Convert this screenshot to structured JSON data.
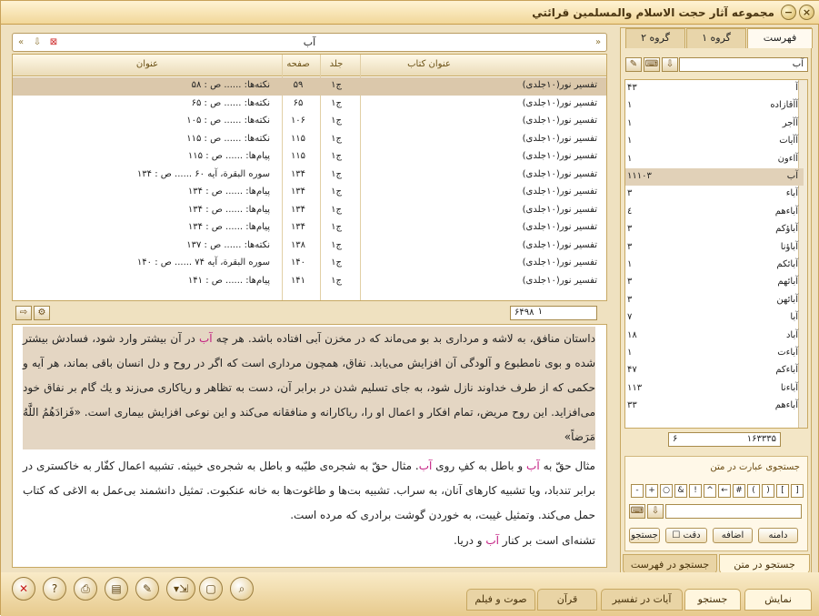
{
  "window": {
    "title": "مجموعه آثار حجت الاسلام والمسلمين قرائتي"
  },
  "search": {
    "query": "آب"
  },
  "table": {
    "headers": {
      "book": "عنوان کتاب",
      "vol": "جلد",
      "page": "صفحه",
      "title": "عنوان"
    },
    "rows": [
      {
        "book": "تفسير نور(١٠جلدى)",
        "vol": "ج١",
        "page": "۵٩",
        "title": "نکته‌ها: ...... ص : ۵٨"
      },
      {
        "book": "تفسير نور(١٠جلدى)",
        "vol": "ج١",
        "page": "۶۵",
        "title": "نکته‌ها: ...... ص : ۶۵"
      },
      {
        "book": "تفسير نور(١٠جلدى)",
        "vol": "ج١",
        "page": "١٠۶",
        "title": "نکته‌ها: ...... ص : ١٠۵"
      },
      {
        "book": "تفسير نور(١٠جلدى)",
        "vol": "ج١",
        "page": "١١۵",
        "title": "نکته‌ها: ...... ص : ١١۵"
      },
      {
        "book": "تفسير نور(١٠جلدى)",
        "vol": "ج١",
        "page": "١١۵",
        "title": "پيام‌ها: ...... ص : ١١۵"
      },
      {
        "book": "تفسير نور(١٠جلدى)",
        "vol": "ج١",
        "page": "١٣۴",
        "title": "سوره البقرة، آيه ۶٠ ...... ص : ١٣۴"
      },
      {
        "book": "تفسير نور(١٠جلدى)",
        "vol": "ج١",
        "page": "١٣۴",
        "title": "پيام‌ها: ...... ص : ١٣۴"
      },
      {
        "book": "تفسير نور(١٠جلدى)",
        "vol": "ج١",
        "page": "١٣۴",
        "title": "پيام‌ها: ...... ص : ١٣۴"
      },
      {
        "book": "تفسير نور(١٠جلدى)",
        "vol": "ج١",
        "page": "١٣۴",
        "title": "پيام‌ها: ...... ص : ١٣۴"
      },
      {
        "book": "تفسير نور(١٠جلدى)",
        "vol": "ج١",
        "page": "١٣٨",
        "title": "نکته‌ها: ...... ص : ١٣٧"
      },
      {
        "book": "تفسير نور(١٠جلدى)",
        "vol": "ج١",
        "page": "١۴٠",
        "title": "سوره البقرة، آيه ٧۴ ...... ص : ١۴٠"
      },
      {
        "book": "تفسير نور(١٠جلدى)",
        "vol": "ج١",
        "page": "١۴١",
        "title": "پيام‌ها: ...... ص : ١۴١"
      }
    ]
  },
  "pager": {
    "total": "۶۴٩٨",
    "current": "١"
  },
  "text": {
    "p1a": "داستان منافق، به لاشه و مردارى بد بو مى‌ماند كه در مخزن آبى افتاده باشد. هر چه ",
    "p1hl": "آب",
    "p1b": " در آن بيشتر وارد شود، فسادش بيشتر شده و بوى نامطبوع و آلودگى آن افزايش مى‌يابد. نفاق، همچون مردارى است كه اگر در روح و دل انسان باقى بماند، هر آيه و حكمى كه از طرف خداوند نازل شود، به جاى تسليم شدن در برابر آن، دست به تظاهر و رياكارى مى‌زند و يك گام بر نفاق خود مى‌افزايد. اين روح مريض، تمام افكار و اعمال او را، رياكارانه و منافقانه مى‌كند و اين نوعى افزايش بيمارى است. «فَزادَهُمُ اللَّهُ مَرَضاً»",
    "p2a": "مثال حقّ به ",
    "p2hl": "آب",
    "p2b": " و باطل به كفِ روى ",
    "p2hl2": "آب",
    "p2c": ". مثال حقّ به شجره‌ى طيّبه و باطل به شجره‌ى خبيثه. تشبيه اعمال كفّار به خاكسترى در برابر تندباد، ويا تشبيه كارهاى آنان، به سراب. تشبيه بت‌ها و طاغوت‌ها به خانه عنكبوت. تمثيل دانشمند بى‌عمل به الاغى كه كتاب حمل مى‌كند. وتمثيل غيبت، به خوردن گوشت برادرى كه مرده است.",
    "p3a": "تشنه‌اى است بر كنار ",
    "p3hl": "آب",
    "p3b": " و دريا."
  },
  "sidebar": {
    "tabs": [
      "فهرست",
      "گروه ١",
      "گروه ٢"
    ],
    "search": "آب",
    "items": [
      {
        "w": "آ",
        "c": "۴٣"
      },
      {
        "w": "آآقازاده",
        "c": "١"
      },
      {
        "w": "آآجر",
        "c": "١"
      },
      {
        "w": "آآيات",
        "c": "١"
      },
      {
        "w": "آاءون",
        "c": "١"
      },
      {
        "w": "آب",
        "c": "١١١٠٣"
      },
      {
        "w": "آباء",
        "c": "٣"
      },
      {
        "w": "آباءهم",
        "c": "٤"
      },
      {
        "w": "آباؤكم",
        "c": "٣"
      },
      {
        "w": "آباؤنا",
        "c": "٣"
      },
      {
        "w": "آبائكم",
        "c": "١"
      },
      {
        "w": "آبائهم",
        "c": "٣"
      },
      {
        "w": "آبائهن",
        "c": "٣"
      },
      {
        "w": "آبا",
        "c": "٧"
      },
      {
        "w": "آباد",
        "c": "١٨"
      },
      {
        "w": "آباءت",
        "c": "١"
      },
      {
        "w": "آباءكم",
        "c": "۴٧"
      },
      {
        "w": "آباءنا",
        "c": "١١٣"
      },
      {
        "w": "آباءهم",
        "c": "٣٣"
      }
    ],
    "count": "١۶٣٣٣۵",
    "countCur": "۶",
    "group_title": "جستجوى عبارت در متن",
    "keys": [
      "[",
      "]",
      "(",
      ")",
      "#",
      "←",
      "^",
      "!",
      "&",
      "○",
      "+",
      "-",
      "=",
      "·"
    ],
    "buttons": {
      "search": "جستجو",
      "exact": "دقت",
      "add": "اضافه",
      "range": "دامنه"
    },
    "bottom_tabs": [
      "جستجو در متن",
      "جستجو در فهرست"
    ]
  },
  "bottom": {
    "tabs": [
      "نمايش",
      "جستجو",
      "آيات در تفسير",
      "قرآن",
      "صوت و فيلم"
    ]
  }
}
